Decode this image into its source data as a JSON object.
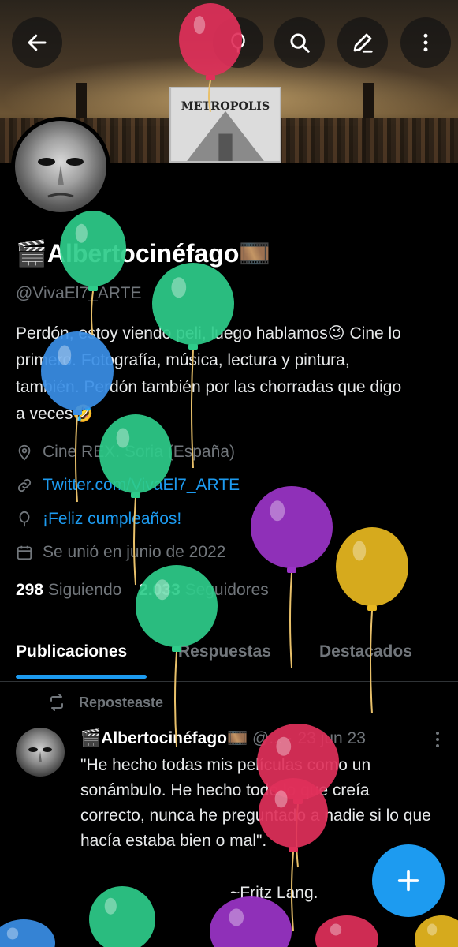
{
  "header": {
    "back_icon": "arrow-left-icon",
    "actions": [
      "birthday-balloon-icon",
      "search-icon",
      "edit-icon",
      "more-vertical-icon"
    ],
    "banner_text": "METROPOLIS"
  },
  "profile": {
    "name": "🎬Albertocinéfago🎞️",
    "handle": "@VivaEl7_ARTE",
    "bio": "Perdón, estoy viendo peli, luego hablamos😉 Cine lo primero. Fotografía, música, lectura y pintura, también. Perdón también por las chorradas que digo a veces🤣",
    "location": "Cine REX.  Soria (España)",
    "website": "Twitter.com/VivaEl7_ARTE",
    "birthday": "¡Feliz cumpleaños!",
    "joined": "Se unió en junio de 2022",
    "following_count": "298",
    "following_label": "Siguiendo",
    "followers_count": "2.033",
    "followers_label": "Seguidores"
  },
  "tabs": [
    "Publicaciones",
    "Respuestas",
    "Destacados"
  ],
  "active_tab": 0,
  "post": {
    "repost_label": "Reposteaste",
    "author": "🎬Albertocinéfago🎞️",
    "handle_trunc": "@...",
    "date": "· 23 jun 23",
    "text": "\"He hecho todas mis películas como un sonámbulo. He hecho todo lo que creía correcto, nunca he preguntado a nadie si lo que hacía estaba bien o mal\".",
    "signature": "~Fritz Lang."
  },
  "fab_icon": "plus-icon",
  "colors": {
    "accent": "#1d9bf0",
    "balloon_green": "#2ecc8a",
    "balloon_blue": "#3a8ee6",
    "balloon_purple": "#9b34c8",
    "balloon_yellow": "#e8b820",
    "balloon_pink": "#e0305a"
  }
}
